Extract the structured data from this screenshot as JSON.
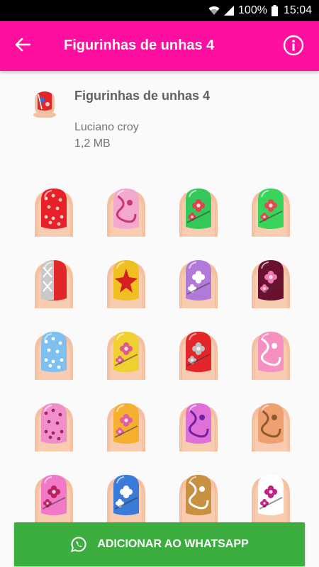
{
  "status_bar": {
    "battery_percent": "100%",
    "time": "15:04",
    "icons": [
      "wifi-icon",
      "signal-icon",
      "battery-icon"
    ]
  },
  "app_bar": {
    "title": "Figurinhas de unhas 4",
    "back_icon": "arrow-left-icon",
    "info_icon": "info-icon",
    "background": "#ff0fa0"
  },
  "pack": {
    "name": "Figurinhas de unhas 4",
    "author": "Luciano croy",
    "size": "1,2 MB"
  },
  "stickers": [
    {
      "base": "#e8202a",
      "accent": "#f7d2c4",
      "pattern": "dots"
    },
    {
      "base": "#f3a8cf",
      "accent": "#c9356e",
      "pattern": "swirl"
    },
    {
      "base": "#34c759",
      "accent": "#e0424a",
      "pattern": "flower"
    },
    {
      "base": "#3ad45a",
      "accent": "#e04a52",
      "pattern": "flower"
    },
    {
      "base": "#e2262a",
      "accent": "#c9c9c9",
      "pattern": "split"
    },
    {
      "base": "#f0c020",
      "accent": "#d62020",
      "pattern": "star"
    },
    {
      "base": "#b27ad8",
      "accent": "#ffffff",
      "pattern": "flower"
    },
    {
      "base": "#6a1030",
      "accent": "#f07ab0",
      "pattern": "flower"
    },
    {
      "base": "#7ec0f0",
      "accent": "#ffffff",
      "pattern": "dots"
    },
    {
      "base": "#f0d030",
      "accent": "#e05a8a",
      "pattern": "flower"
    },
    {
      "base": "#e2262a",
      "accent": "#c0c0c0",
      "pattern": "flower"
    },
    {
      "base": "#f590c0",
      "accent": "#ffffff",
      "pattern": "swirl"
    },
    {
      "base": "#f090c8",
      "accent": "#a42070",
      "pattern": "dots"
    },
    {
      "base": "#f5b030",
      "accent": "#e060a0",
      "pattern": "flower"
    },
    {
      "base": "#e070d8",
      "accent": "#7020a0",
      "pattern": "swirl"
    },
    {
      "base": "#f0a070",
      "accent": "#8a5a30",
      "pattern": "swirl"
    },
    {
      "base": "#f07ac8",
      "accent": "#c02060",
      "pattern": "flower"
    },
    {
      "base": "#3a7ad8",
      "accent": "#ffffff",
      "pattern": "flower"
    },
    {
      "base": "#c89040",
      "accent": "#ffffff",
      "pattern": "swirl"
    },
    {
      "base": "#ffffff",
      "accent": "#c02080",
      "pattern": "flower"
    }
  ],
  "footer": {
    "button_label": "ADICIONAR AO WHATSAPP",
    "button_icon": "whatsapp-icon",
    "button_color": "#3cae3f"
  }
}
